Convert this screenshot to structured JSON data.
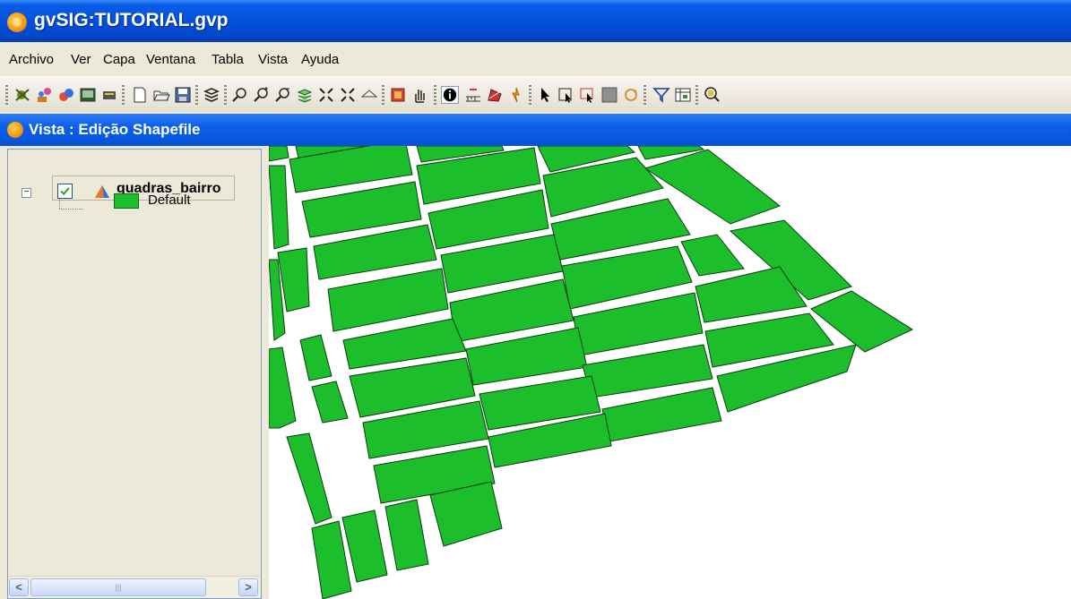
{
  "window": {
    "title": "gvSIG:TUTORIAL.gvp"
  },
  "menu": [
    "Archivo",
    "Ver",
    "Capa",
    "Ventana",
    "Tabla",
    "Vista",
    "Ayuda"
  ],
  "toolbar": {
    "icons": [
      "add-layer-icon",
      "georef-icon",
      "geoprocess-icon",
      "console-icon",
      "catalog-icon",
      "new-project-icon",
      "open-project-icon",
      "save-project-icon",
      "layers-icon",
      "zoom-previous-icon",
      "zoom-in-icon",
      "zoom-out-icon",
      "zoom-all-layers-icon",
      "zoom-select-icon",
      "zoom-full-icon",
      "zoom-back-icon",
      "locator-icon",
      "pan-icon",
      "info-icon",
      "measure-distance-icon",
      "measure-area-icon",
      "hyperlink-icon",
      "select-pointer-icon",
      "select-rectangle-icon",
      "select-polygon-icon",
      "select-by-layer-icon",
      "invert-selection-icon",
      "filter-icon",
      "table-icon",
      "zoom-to-selection-icon"
    ]
  },
  "view": {
    "title": "Vista : Edição Shapefile"
  },
  "toc": {
    "layer": {
      "name": "quadras_bairro",
      "visible": true
    },
    "legend": {
      "label": "Default",
      "color": "#1cbf2b"
    }
  },
  "map": {
    "fill": "#1cbf2b",
    "stroke": "#0b3d10"
  }
}
